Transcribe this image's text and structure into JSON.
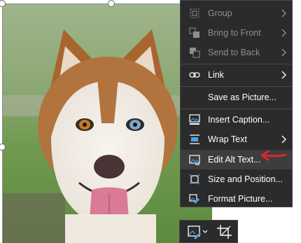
{
  "menu": {
    "items": [
      {
        "label": "Group",
        "icon": "group-icon",
        "disabled": true,
        "submenu": true
      },
      {
        "label": "Bring to Front",
        "icon": "bring-to-front-icon",
        "disabled": true,
        "submenu": true
      },
      {
        "label": "Send to Back",
        "icon": "send-to-back-icon",
        "disabled": true,
        "submenu": true
      },
      {
        "label": "Link",
        "icon": "link-icon",
        "disabled": false,
        "submenu": true
      },
      {
        "label": "Save as Picture...",
        "icon": "",
        "disabled": false,
        "submenu": false
      },
      {
        "label": "Insert Caption...",
        "icon": "insert-caption-icon",
        "disabled": false,
        "submenu": false
      },
      {
        "label": "Wrap Text",
        "icon": "wrap-text-icon",
        "disabled": false,
        "submenu": true
      },
      {
        "label": "Edit Alt Text...",
        "icon": "edit-alt-text-icon",
        "disabled": false,
        "submenu": false,
        "highlighted": true
      },
      {
        "label": "Size and Position...",
        "icon": "size-and-position-icon",
        "disabled": false,
        "submenu": false
      },
      {
        "label": "Format Picture...",
        "icon": "format-picture-icon",
        "disabled": false,
        "submenu": false
      }
    ]
  },
  "toolbar": {
    "buttons": [
      "style-icon",
      "crop-icon"
    ]
  },
  "annotation": {
    "arrow_color": "#d9262c"
  },
  "colors": {
    "menu_bg": "#2b2b2b",
    "menu_text": "#ffffff",
    "disabled_text": "#8f8f8f",
    "highlight_bg": "#3d3d3d",
    "icon_blue": "#4aa3e8"
  }
}
